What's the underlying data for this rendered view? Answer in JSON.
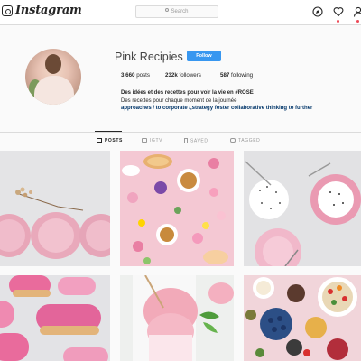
{
  "topbar": {
    "brand": "Instagram",
    "search_placeholder": "Search",
    "icons": [
      "instagram-glyph-icon",
      "compass-icon",
      "heart-icon",
      "person-icon"
    ]
  },
  "profile": {
    "username": "Pink Recipies",
    "follow_label": "Follow",
    "stats": {
      "posts_num": "3,660",
      "posts_label": " posts",
      "followers_num": "232k",
      "followers_label": " followers",
      "following_num": "587",
      "following_label": " following"
    },
    "bio": {
      "name": "Des idées et des recettes pour voir la vie en #ROSE",
      "line2": "Des recettes pour chaque moment de la journée",
      "link": "approaches / to corporate /,strategy foster collaborative thinking to further"
    }
  },
  "tabs": [
    {
      "label": "POSTS",
      "icon": "grid-icon",
      "active": true
    },
    {
      "label": "IGTV",
      "icon": "tv-icon",
      "active": false
    },
    {
      "label": "SAVED",
      "icon": "bookmark-icon",
      "active": false
    },
    {
      "label": "TAGGED",
      "icon": "tag-icon",
      "active": false
    }
  ],
  "colors": {
    "accent": "#3897f0",
    "link": "#003569",
    "pink": "#f2b8c6",
    "notification": "#ed4956"
  }
}
